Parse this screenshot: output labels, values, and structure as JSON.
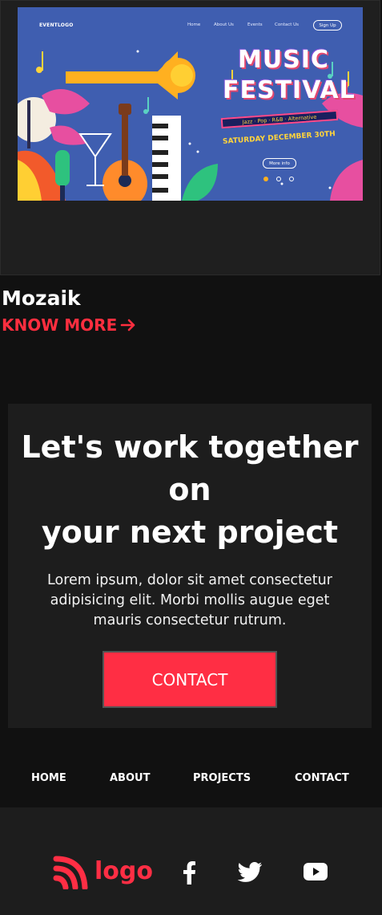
{
  "project": {
    "screenshot": {
      "logo": "EVENTLOGO",
      "nav": [
        "Home",
        "About Us",
        "Events",
        "Contact Us"
      ],
      "signup": "Sign Up",
      "title_line1": "MUSIC",
      "title_line2": "FESTIVAL",
      "genres": "Jazz · Pop · R&B · Alternative",
      "date": "SATURDAY DECEMBER 30TH",
      "more_info": "More info"
    },
    "title": "Mozaik",
    "link_label": "KNOW MORE",
    "link_icon": "arrow-right-icon"
  },
  "cta": {
    "heading_line1": "Let's work together",
    "heading_line2": "on",
    "heading_line3": "your next project",
    "text": "Lorem ipsum, dolor sit amet consectetur adipisicing elit. Morbi mollis augue eget mauris consectetur rutrum.",
    "button_label": "CONTACT"
  },
  "footer_nav": [
    "HOME",
    "ABOUT",
    "PROJECTS",
    "CONTACT"
  ],
  "footer": {
    "logo_text": "logo",
    "logo_icon": "rss-logo-icon",
    "social_icons": [
      "facebook-icon",
      "twitter-icon",
      "youtube-icon"
    ]
  },
  "colors": {
    "accent": "#ff2e44",
    "background": "#111111",
    "panel": "#1d1d1d"
  }
}
